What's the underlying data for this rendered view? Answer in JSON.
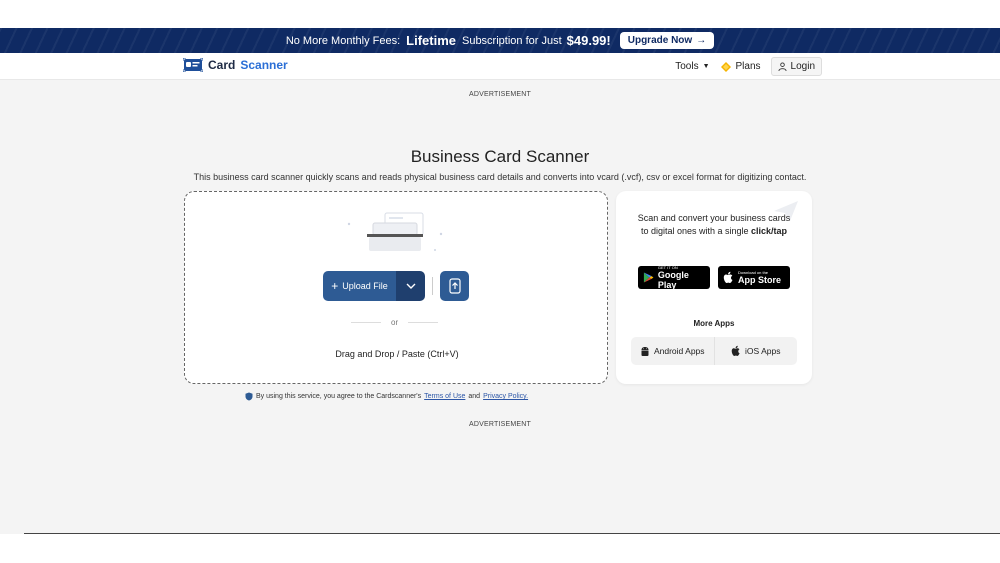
{
  "promo": {
    "text1": "No More Monthly Fees:",
    "highlight": "Lifetime",
    "text2": "Subscription for Just",
    "price": "$49.99!",
    "button_label": "Upgrade Now",
    "button_icon": "arrow-right-icon"
  },
  "nav": {
    "brand_part1": "Card",
    "brand_part2": "Scanner",
    "tools_label": "Tools",
    "plans_label": "Plans",
    "login_label": "Login"
  },
  "ads": {
    "top": "ADVERTISEMENT",
    "bottom": "ADVERTISEMENT"
  },
  "main": {
    "title": "Business Card Scanner",
    "subtitle": "This business card scanner quickly scans and reads physical business card details and converts into vcard (.vcf), csv or excel format for digitizing contact."
  },
  "dropzone": {
    "upload_label": "Upload File",
    "or_label": "or",
    "drag_text": "Drag and Drop / Paste (Ctrl+V)"
  },
  "side": {
    "text": "Scan and convert your business cards to digital ones with a single",
    "text_bold": "click/tap",
    "google_small": "GET IT ON",
    "google_big": "Google Play",
    "apple_small": "Download on the",
    "apple_big": "App Store",
    "more_apps": "More Apps",
    "android_label": "Android Apps",
    "ios_label": "iOS Apps"
  },
  "terms": {
    "prefix": "By using this service, you agree to the Cardscanner's",
    "terms_link": "Terms of Use",
    "and": "and",
    "privacy_link": "Privacy Policy."
  },
  "colors": {
    "promo_bg": "#0f2a63",
    "primary": "#2e5b94",
    "brand_accent": "#2b6fd6"
  }
}
